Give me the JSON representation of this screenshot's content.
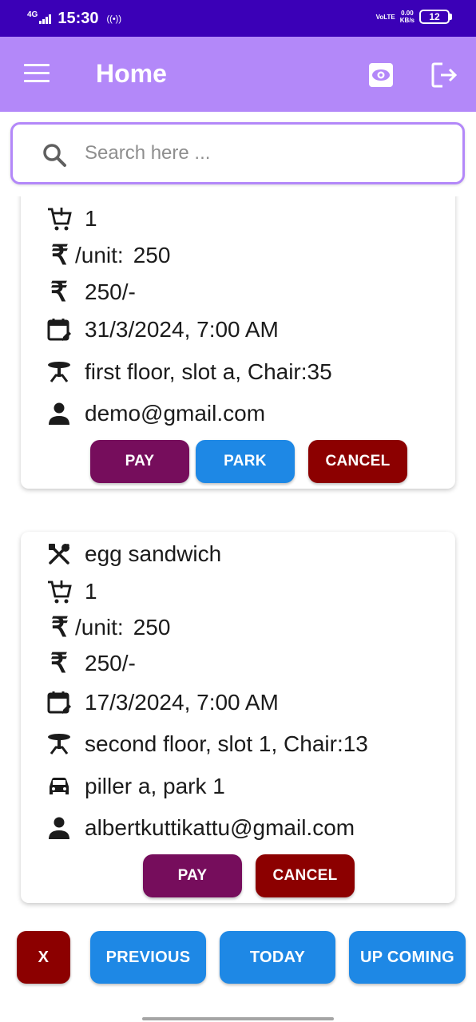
{
  "status_bar": {
    "network_type": "4G",
    "time": "15:30",
    "hotspot": "((•))",
    "volte": "VoLTE",
    "speed_value": "0.00",
    "speed_unit": "KB/s",
    "battery": "12"
  },
  "app_bar": {
    "title": "Home",
    "icons": [
      "menu-icon",
      "eye-icon",
      "logout-icon"
    ]
  },
  "search": {
    "placeholder": "Search here ..."
  },
  "currency_symbol": "₹",
  "orders": [
    {
      "quantity": "1",
      "unit_label": "/unit:",
      "unit_price": "250",
      "total": "250/-",
      "datetime": "31/3/2024,  7:00 AM",
      "seat": "first floor, slot a, Chair:35",
      "user": "demo@gmail.com",
      "buttons": {
        "pay": "PAY",
        "park": "PARK",
        "cancel": "CANCEL"
      }
    },
    {
      "item": "egg sandwich",
      "quantity": "1",
      "unit_label": "/unit:",
      "unit_price": "250",
      "total": "250/-",
      "datetime": "17/3/2024,  7:00 AM",
      "seat": "second floor, slot 1, Chair:13",
      "parking": "piller a, park 1",
      "user": "albertkuttikattu@gmail.com",
      "buttons": {
        "pay": "PAY",
        "cancel": "CANCEL"
      }
    }
  ],
  "bottom_nav": {
    "close": "X",
    "previous": "PREVIOUS",
    "today": "TODAY",
    "upcoming": "UP COMING"
  },
  "colors": {
    "status_bar": "#3b00b7",
    "app_bar": "#b388f9",
    "pay": "#760d5c",
    "park": "#1e88e5",
    "cancel": "#8c0000"
  }
}
